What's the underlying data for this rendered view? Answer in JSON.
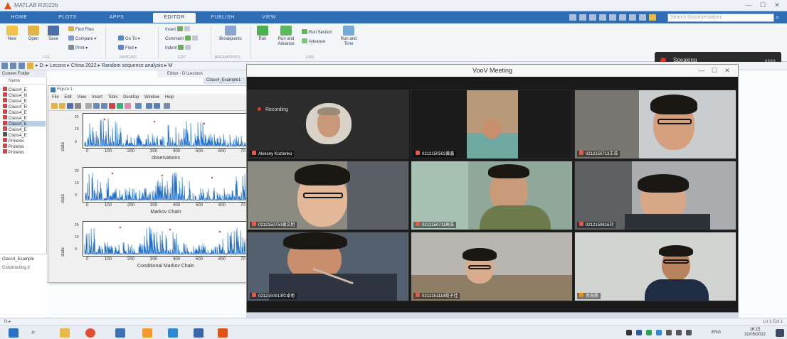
{
  "titlebar": {
    "title": "MATLAB R2022b"
  },
  "tabs": [
    "HOME",
    "PLOTS",
    "APPS",
    "EDITOR",
    "PUBLISH",
    "VIEW"
  ],
  "active_tab": "EDITOR",
  "search_placeholder": "Search Documentation",
  "toolstrip": {
    "new": "New",
    "open": "Open",
    "save": "Save",
    "find_files": "Find Files",
    "compare": "Compare",
    "print": "Print",
    "go_to": "Go To",
    "find": "Find",
    "insert": "Insert",
    "comment": "Comment",
    "indent": "Indent",
    "breakpoints": "Breakpoints",
    "run": "Run",
    "run_and_advance": "Run and Advance",
    "run_section": "Run Section",
    "advance": "Advance",
    "run_and_time": "Run and Time",
    "group_file": "FILE",
    "group_navigate": "NAVIGATE",
    "group_edit": "EDIT",
    "group_breakpoints": "BREAKPOINTS",
    "group_run": "RUN"
  },
  "speaking": {
    "label": "Speaking"
  },
  "addressbar": {
    "path": "▸ D: ▸ Lecons ▸ China 2022 ▸ Random sequence analysis ▸ M"
  },
  "current_folder": {
    "title": "Current Folder",
    "col_name": "Name"
  },
  "files": [
    "Class4_E",
    "Class4_N",
    "Class4_E",
    "Class4_R",
    "Class4_E",
    "Class4_E",
    "Class4_E",
    "Class4_E",
    "Class4_E",
    "Proteins",
    "Proteins",
    "Proteins"
  ],
  "details": {
    "file": "Class4_Example",
    "status": "Constructing d"
  },
  "editor": {
    "title": "Editor - D:\\Lecons\\",
    "tab": "Class4_Example1"
  },
  "figure": {
    "title": "Figure 1",
    "menu": "File Edit View Insert Tools Desktop Window Help"
  },
  "plots": [
    {
      "xlabel": "observations",
      "ylabel": "state",
      "yticks": [
        "20",
        "10",
        "0"
      ],
      "xticks": [
        "0",
        "100",
        "200",
        "300",
        "400",
        "500",
        "600",
        "70"
      ]
    },
    {
      "xlabel": "Markov Chain",
      "ylabel": "state",
      "yticks": [
        "20",
        "10",
        "0"
      ],
      "xticks": [
        "0",
        "100",
        "200",
        "300",
        "400",
        "500",
        "600",
        "70"
      ]
    },
    {
      "xlabel": "Conditional Markov Chain",
      "ylabel": "state",
      "yticks": [
        "20",
        "10",
        "0"
      ],
      "xticks": [
        "0",
        "100",
        "200",
        "300",
        "400",
        "500",
        "600",
        "70"
      ]
    }
  ],
  "meeting": {
    "title": "VooV Meeting",
    "recording": "Recording",
    "participants": [
      {
        "name": "Aleksey Kozlenko"
      },
      {
        "name": "0212150502黄鑫"
      },
      {
        "name": "0212150713王浩"
      },
      {
        "name": "0212150750谢文旭"
      },
      {
        "name": "0212150711高浩"
      },
      {
        "name": "0212150816刘"
      },
      {
        "name": "0212150913杜卓思"
      },
      {
        "name": "0212151118晓子佳"
      },
      {
        "name": "冉海燕"
      }
    ]
  },
  "taskbar": {
    "time": "16:15",
    "date": "31/05/2022",
    "lang": "ENG"
  },
  "statusbar": {
    "text": "Ln 1   Col 1"
  },
  "colors": {
    "accent": "#2e6db4",
    "meeting_bg": "#1a1a1a",
    "plot_series": "#1f6ec8"
  }
}
